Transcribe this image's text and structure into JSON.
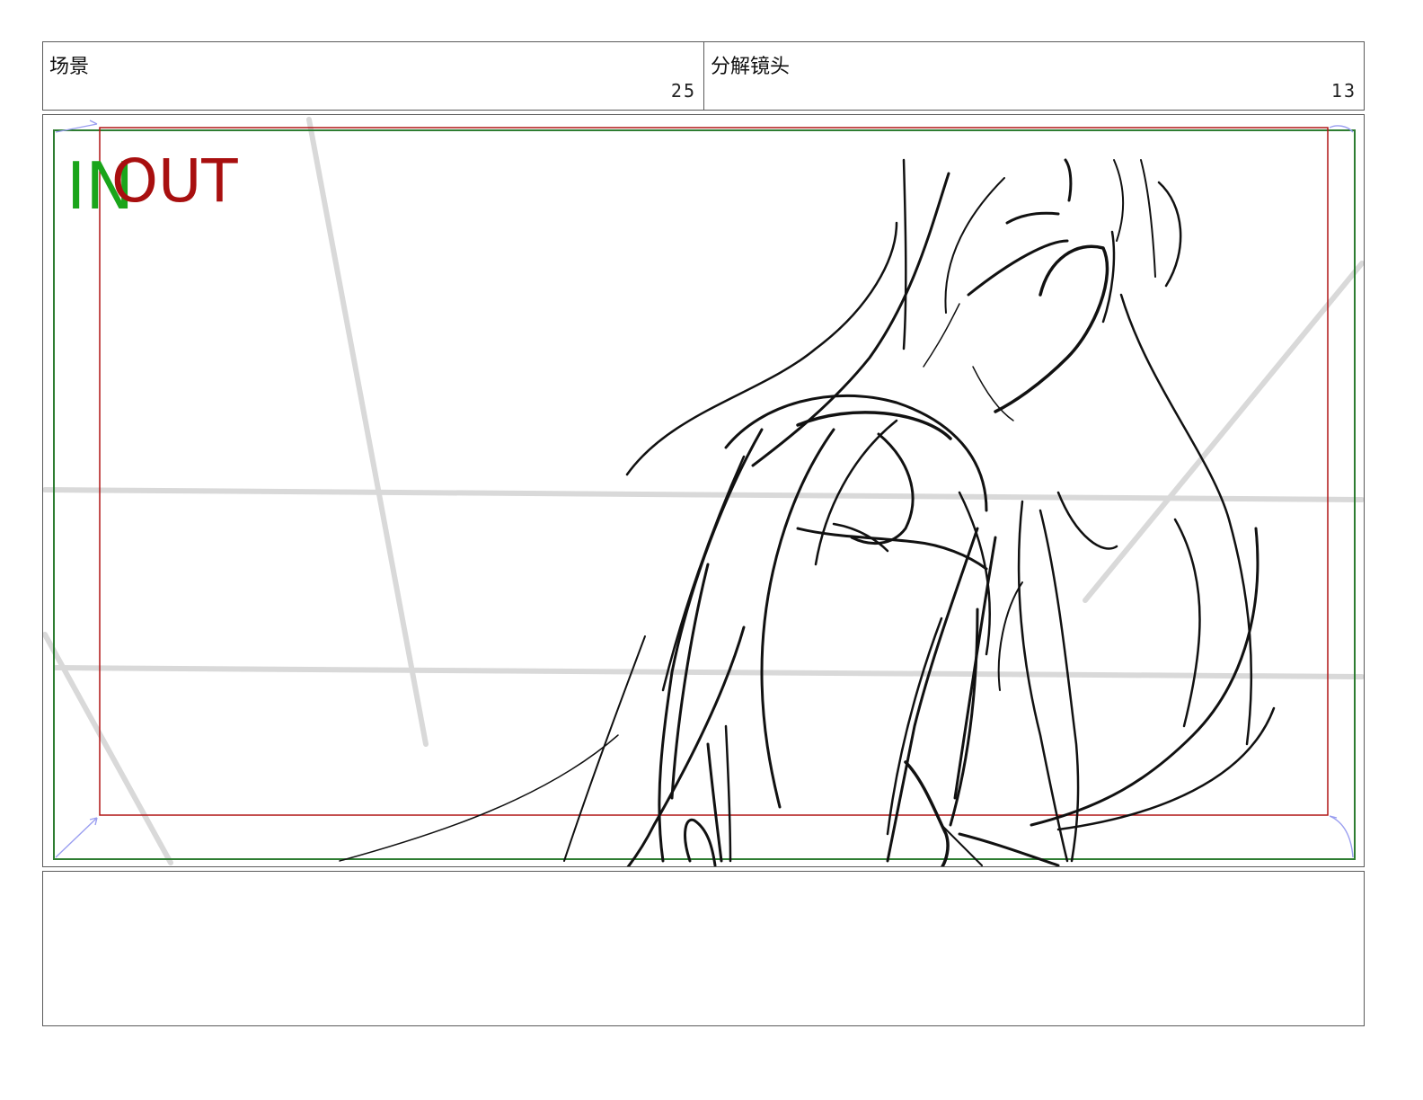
{
  "header": {
    "scene_label": "场景",
    "scene_number": "25",
    "shot_label": "分解镜头",
    "shot_number": "13"
  },
  "panel": {
    "in_label": "IN",
    "out_label": "OUT",
    "colors": {
      "in_frame": "#2e7d32",
      "in_text": "#1aa51a",
      "out_frame": "#b01515",
      "out_text": "#a80f0f",
      "guide_lines": "#d9d9d9",
      "sketch": "#111111",
      "corner_arrows": "#9a9ef0"
    }
  },
  "notes": {
    "text": ""
  }
}
